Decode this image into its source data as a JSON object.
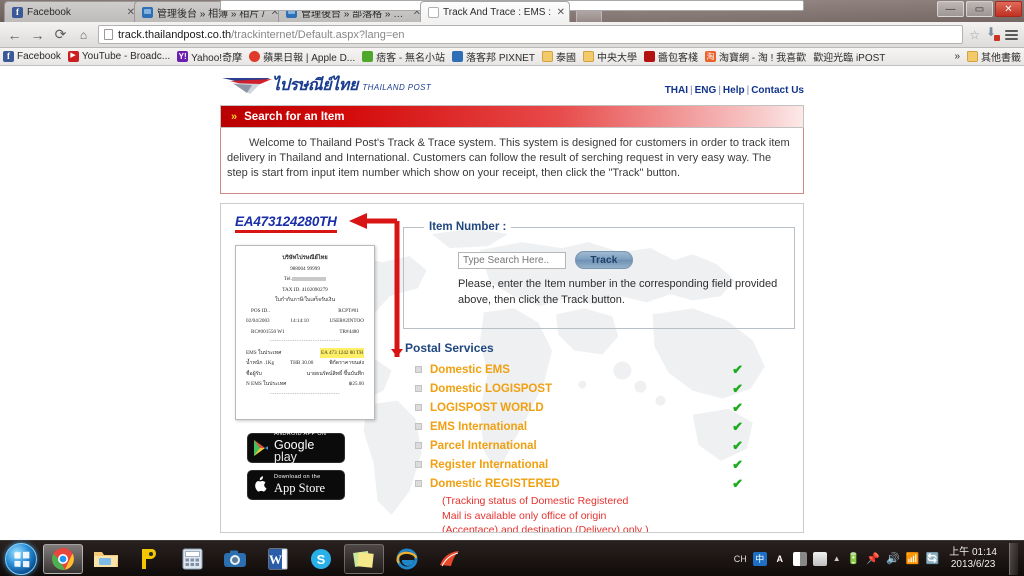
{
  "browser": {
    "tabs": [
      {
        "title": "Facebook",
        "favicon": "facebook-icon",
        "active": false
      },
      {
        "title": "管理後台 » 相簿 » 相片 /",
        "favicon": "blog-icon",
        "active": false
      },
      {
        "title": "管理後台 » 部落格 » 發表",
        "favicon": "blog-icon",
        "active": false
      },
      {
        "title": "Track And Trace : EMS :",
        "favicon": "page-icon",
        "active": true
      }
    ],
    "window_controls": {
      "minimize": "—",
      "maximize": "▭",
      "close": "✕"
    },
    "nav": {
      "back": "←",
      "forward": "→",
      "reload": "C",
      "home": "⌂"
    },
    "omnibox": {
      "url_strong": "track.thailandpost.co.th",
      "url_dim": "/trackinternet/Default.aspx?lang=en",
      "star": "☆"
    },
    "bookmarks": [
      {
        "label": "Facebook",
        "icon": "facebook-icon"
      },
      {
        "label": "YouTube - Broadc...",
        "icon": "youtube-icon"
      },
      {
        "label": "Yahoo!奇摩",
        "icon": "yahoo-icon"
      },
      {
        "label": "蘋果日報 | Apple D...",
        "icon": "apple-daily-icon"
      },
      {
        "label": "痞客 - 無名小站",
        "icon": "wretch-icon"
      },
      {
        "label": "落客邦 PIXNET",
        "icon": "pixnet-icon"
      },
      {
        "label": "泰國",
        "icon": "folder-icon"
      },
      {
        "label": "中央大學",
        "icon": "folder-icon"
      },
      {
        "label": "醬包客棧",
        "icon": "red-icon"
      },
      {
        "label": "淘寶網 - 淘 ! 我喜歡",
        "icon": "taobao-icon"
      },
      {
        "label": "歡迎光臨 iPOST",
        "icon": "page-icon"
      }
    ],
    "bookmarks_overflow": "»",
    "other_bookmarks": {
      "label": "其他書籤",
      "icon": "folder-icon"
    }
  },
  "page": {
    "logo": {
      "thai": "ไปรษณีย์ไทย",
      "english": "THAILAND POST"
    },
    "toplinks": [
      {
        "label": "THAI"
      },
      {
        "label": "ENG"
      },
      {
        "label": "Help"
      },
      {
        "label": "Contact Us"
      }
    ],
    "header_bar": {
      "chevron": "»",
      "title": "Search for an Item"
    },
    "intro": "Welcome to Thailand Post's Track & Trace system. This system is designed for customers in order to track item delivery in Thailand and International. Customers can follow the result of serching request in very easy way. The step is start from input item number which show on your receipt, then click the \"Track\" button.",
    "tracking_number": "EA473124280TH",
    "receipt": {
      "company": "บริษัทไปรษณีย์ไทย",
      "branch": "988004 99999",
      "tel_label": "Tel.",
      "tax": "TAX ID. 4102090279",
      "doc_type": "ใบกำกับภาษี/ใบเสร็จรับเงิน",
      "pos_id": "POS ID..",
      "rcpt": "RCPT#01",
      "date": "02/04/2003",
      "time": "14:14:10",
      "user": "USER#2INTOO",
      "rc": "RC#001550 W1",
      "tr": "TR#4480",
      "item_label": "EMS ในประเทศ",
      "item_value": "EA 473 1242 80 TH",
      "weight_label": "น้ำหนัก .1Kg",
      "weight_price": "THB 30.00",
      "weight_note": "พิกัดราคาขนส่ง",
      "recipient_label": "ชื่อผู้รับ",
      "recipient_value": "นายธนรัตน์สิทธิ์ ขึ้นบันทึก",
      "total_label": "N EMS ในประเทศ",
      "total_value": "฿25.00"
    },
    "badges": [
      {
        "top": "ANDROID APP ON",
        "main": "Google",
        "main_light": "play",
        "icon": "google-play-icon"
      },
      {
        "top": "Download on the",
        "main": "App Store",
        "icon": "apple-icon"
      }
    ],
    "item_number": {
      "legend": "Item Number :",
      "input_placeholder": "Type Search Here..",
      "input_value": "",
      "button_label": "Track",
      "note": "Please, enter the Item number in the corresponding field provided above, then click the Track button."
    },
    "postal_services": {
      "title": "Postal Services",
      "items": [
        {
          "label": "Domestic EMS",
          "check": "✔"
        },
        {
          "label": "Domestic LOGISPOST",
          "check": "✔"
        },
        {
          "label": "LOGISPOST WORLD",
          "check": "✔"
        },
        {
          "label": "EMS International",
          "check": "✔"
        },
        {
          "label": "Parcel International",
          "check": "✔"
        },
        {
          "label": "Register International",
          "check": "✔"
        },
        {
          "label": "Domestic REGISTERED",
          "check": "✔"
        }
      ],
      "note_line1": "(Tracking status of Domestic Registered",
      "note_line2": "Mail is available only office of origin",
      "note_line3": "(Acceptace) and destination (Delivery) only )"
    }
  },
  "taskbar": {
    "start": "start-orb",
    "items": [
      {
        "name": "chrome-taskbar-icon",
        "active": true
      },
      {
        "name": "file-explorer-taskbar-icon",
        "active": false
      },
      {
        "name": "pixnet-taskbar-icon",
        "active": false
      },
      {
        "name": "calculator-taskbar-icon",
        "active": false
      },
      {
        "name": "camera-taskbar-icon",
        "active": false
      },
      {
        "name": "word-taskbar-icon",
        "active": false
      },
      {
        "name": "skype-taskbar-icon",
        "active": false
      },
      {
        "name": "sticky-notes-taskbar-icon",
        "active": false
      },
      {
        "name": "internet-explorer-taskbar-icon",
        "active": false
      },
      {
        "name": "foxit-taskbar-icon",
        "active": false
      }
    ],
    "tray": {
      "ime_mode": "CH",
      "ime_chinese": "中",
      "ime_letter": "A",
      "overflow_arrow": "▲",
      "battery": "🔋",
      "pin": "📌",
      "volume": "🔊",
      "network": "📶",
      "update": "🔄"
    },
    "clock": {
      "time": "上午 01:14",
      "date": "2013/6/23"
    }
  }
}
